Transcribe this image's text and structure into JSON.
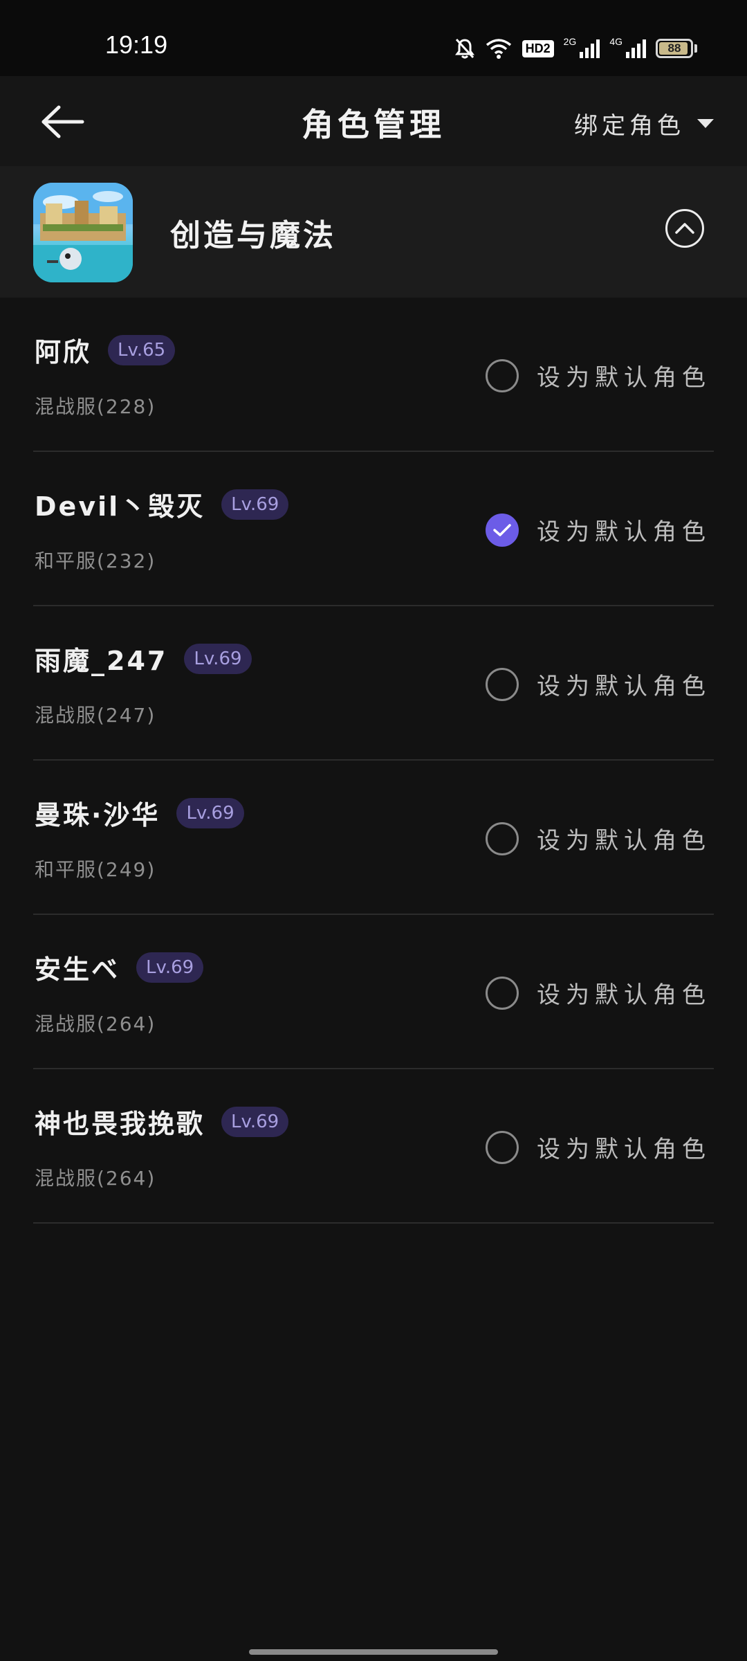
{
  "status_bar": {
    "time": "19:19",
    "hd_label": "HD2",
    "network_1": "2G",
    "network_2": "4G",
    "battery": "88"
  },
  "nav": {
    "title": "角色管理",
    "bind_label": "绑定角色"
  },
  "game": {
    "name": "创造与魔法"
  },
  "default_option_label": "设为默认角色",
  "roles": [
    {
      "name": "阿欣",
      "level": "Lv.65",
      "server": "混战服(228)",
      "is_default": false
    },
    {
      "name": "Devil丶毁灭",
      "level": "Lv.69",
      "server": "和平服(232)",
      "is_default": true
    },
    {
      "name": "雨魔_247",
      "level": "Lv.69",
      "server": "混战服(247)",
      "is_default": false
    },
    {
      "name": "曼珠·沙华",
      "level": "Lv.69",
      "server": "和平服(249)",
      "is_default": false
    },
    {
      "name": "安生ベ",
      "level": "Lv.69",
      "server": "混战服(264)",
      "is_default": false
    },
    {
      "name": "神也畏我挽歌",
      "level": "Lv.69",
      "server": "混战服(264)",
      "is_default": false
    }
  ],
  "colors": {
    "accent": "#6c5ce7",
    "badge_bg": "#2e2752",
    "background": "#121212"
  }
}
